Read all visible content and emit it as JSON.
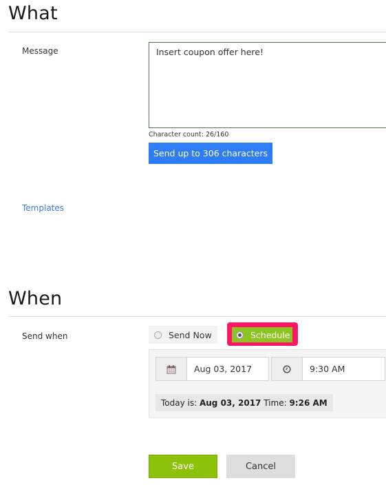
{
  "what": {
    "title": "What",
    "message_label": "Message",
    "message_value": "Insert coupon offer here!",
    "char_count_label": "Character count: 26/160",
    "send_up_button": "Send up to 306 characters",
    "templates_link": "Templates"
  },
  "when": {
    "title": "When",
    "send_when_label": "Send when",
    "options": [
      {
        "label": "Send Now",
        "selected": false
      },
      {
        "label": "Schedule",
        "selected": true
      }
    ],
    "date_value": "Aug 03, 2017",
    "time_value": "9:30 AM",
    "date_icon": "calendar-icon",
    "time_icon": "clock-icon",
    "today_prefix": "Today is: ",
    "today_date": "Aug 03, 2017",
    "time_prefix": " Time: ",
    "today_time": "9:26 AM"
  },
  "actions": {
    "save": "Save",
    "cancel": "Cancel"
  },
  "colors": {
    "primary_blue": "#2e7cf6",
    "green": "#8cc20a",
    "highlight": "#fb1766",
    "link": "#3b7dd8"
  }
}
